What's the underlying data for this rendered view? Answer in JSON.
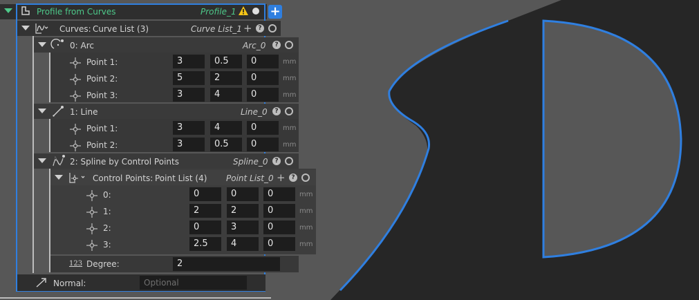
{
  "root": {
    "title": "Profile from Curves",
    "instance": "Profile_1",
    "add_button": "+"
  },
  "curves": {
    "label": "Curves:",
    "type": "Curve List (3)",
    "instance": "Curve List_1",
    "add_symbol": "+"
  },
  "arc": {
    "label": "0:  Arc",
    "instance": "Arc_0",
    "points": [
      {
        "label": "Point 1:",
        "values": [
          "3",
          "0.5",
          "0"
        ],
        "unit": "mm"
      },
      {
        "label": "Point 2:",
        "values": [
          "5",
          "2",
          "0"
        ],
        "unit": "mm"
      },
      {
        "label": "Point 3:",
        "values": [
          "3",
          "4",
          "0"
        ],
        "unit": "mm"
      }
    ]
  },
  "line": {
    "label": "1:  Line",
    "instance": "Line_0",
    "points": [
      {
        "label": "Point 1:",
        "values": [
          "3",
          "4",
          "0"
        ],
        "unit": "mm"
      },
      {
        "label": "Point 2:",
        "values": [
          "3",
          "0.5",
          "0"
        ],
        "unit": "mm"
      }
    ]
  },
  "spline": {
    "label": "2:  Spline by Control Points",
    "instance": "Spline_0",
    "control_points": {
      "label": "Control Points:",
      "type": "Point List (4)",
      "instance": "Point List_0",
      "add_symbol": "+",
      "points": [
        {
          "label": "0:",
          "values": [
            "0",
            "0",
            "0"
          ],
          "unit": "mm"
        },
        {
          "label": "1:",
          "values": [
            "2",
            "2",
            "0"
          ],
          "unit": "mm"
        },
        {
          "label": "2:",
          "values": [
            "0",
            "3",
            "0"
          ],
          "unit": "mm"
        },
        {
          "label": "3:",
          "values": [
            "2.5",
            "4",
            "0"
          ],
          "unit": "mm"
        }
      ]
    },
    "degree": {
      "icon_text": "123",
      "label": "Degree:",
      "value": "2"
    }
  },
  "normal": {
    "label": "Normal:",
    "placeholder": "Optional"
  },
  "icons": {
    "warning": "warning-icon",
    "status": "status-dot-icon",
    "help": "question-mark-icon",
    "disable": "circle-toggle-icon",
    "point": "point-crosshair-icon"
  },
  "colors": {
    "accent": "#2f7fe0",
    "title_green": "#4ec98a",
    "warning": "#f5c518",
    "shape_fill": "#575757",
    "background": "#262626"
  }
}
